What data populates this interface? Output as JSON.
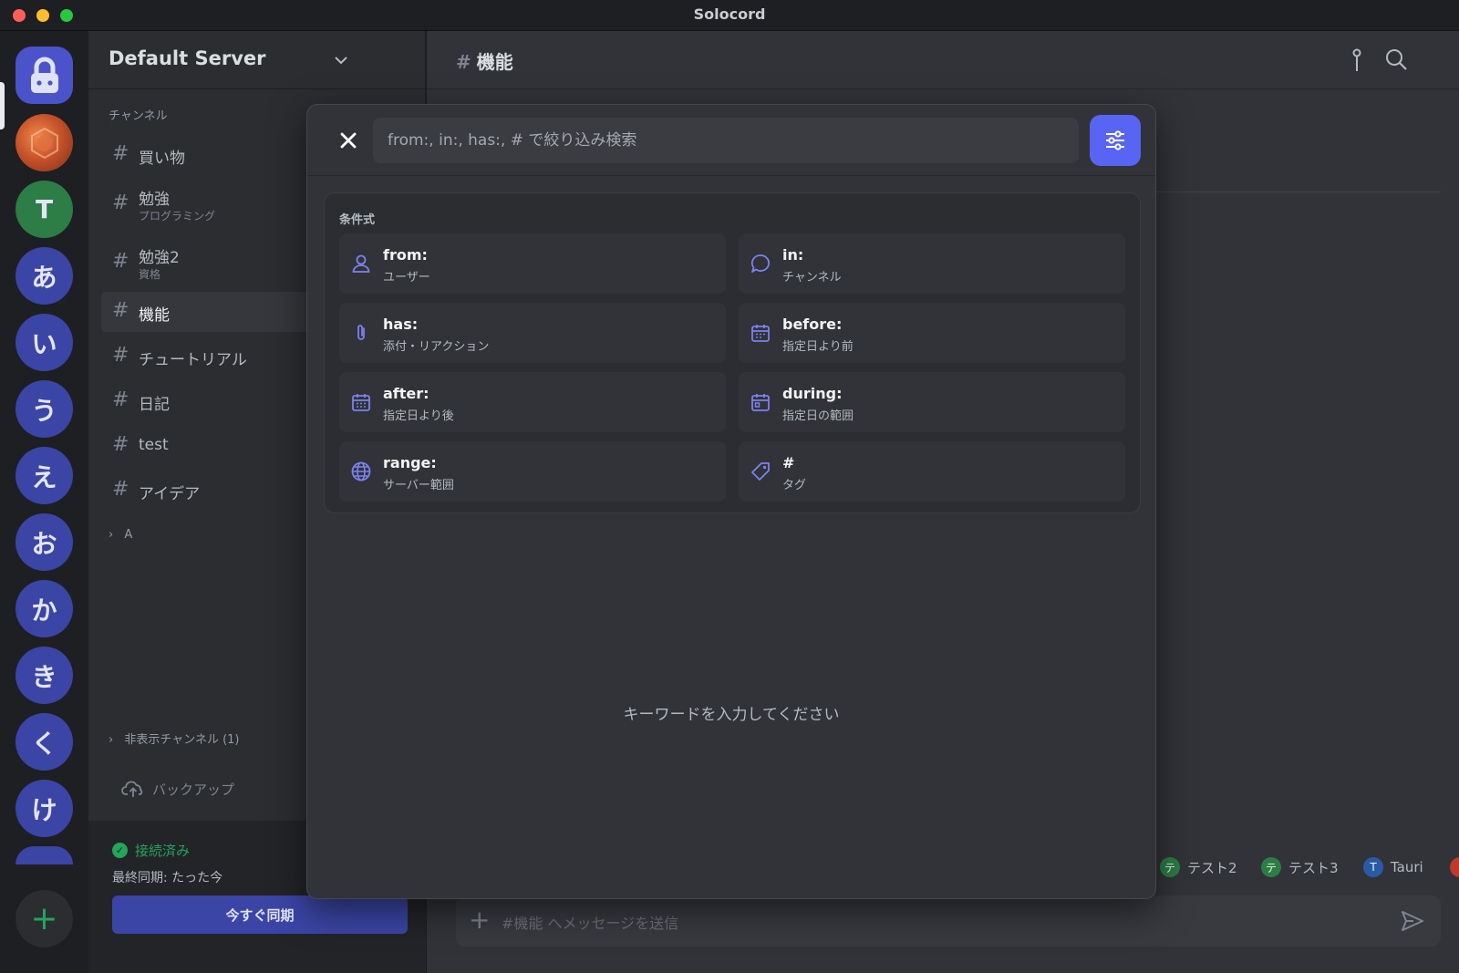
{
  "window": {
    "title": "Solocord"
  },
  "rail": {
    "items": [
      {
        "label": "T"
      },
      {
        "label": "あ"
      },
      {
        "label": "い"
      },
      {
        "label": "う"
      },
      {
        "label": "え"
      },
      {
        "label": "お"
      },
      {
        "label": "か"
      },
      {
        "label": "き"
      },
      {
        "label": "く"
      },
      {
        "label": "け"
      }
    ],
    "add_label": "+"
  },
  "sidebar": {
    "server_name": "Default Server",
    "section_label": "チャンネル",
    "channels": [
      {
        "name": "買い物",
        "sub": ""
      },
      {
        "name": "勉強",
        "sub": "プログラミング"
      },
      {
        "name": "勉強2",
        "sub": "資格"
      },
      {
        "name": "機能",
        "sub": ""
      },
      {
        "name": "チュートリアル",
        "sub": ""
      },
      {
        "name": "日記",
        "sub": ""
      },
      {
        "name": "test",
        "sub": ""
      },
      {
        "name": "アイデア",
        "sub": ""
      }
    ],
    "folder_a": "A",
    "hidden_channels": "非表示チャンネル (1)",
    "backup_label": "バックアップ",
    "status": "接続済み",
    "last_sync": "最終同期: たった今",
    "sync_button": "今すぐ同期"
  },
  "main": {
    "channel_title": "機能",
    "hash": "#",
    "members": [
      "テスト2",
      "テスト3",
      "Tauri"
    ],
    "member_initials": [
      "テ",
      "テ",
      "T"
    ],
    "composer_placeholder": "#機能 へメッセージを送信"
  },
  "search_modal": {
    "placeholder": "from:, in:, has:, # で絞り込み検索",
    "conditions_title": "条件式",
    "conditions": [
      {
        "key": "from:",
        "desc": "ユーザー",
        "icon": "user-icon"
      },
      {
        "key": "in:",
        "desc": "チャンネル",
        "icon": "chat-bubble-icon"
      },
      {
        "key": "has:",
        "desc": "添付・リアクション",
        "icon": "paperclip-icon"
      },
      {
        "key": "before:",
        "desc": "指定日より前",
        "icon": "calendar-icon"
      },
      {
        "key": "after:",
        "desc": "指定日より後",
        "icon": "calendar-icon"
      },
      {
        "key": "during:",
        "desc": "指定日の範囲",
        "icon": "calendar-icon"
      },
      {
        "key": "range:",
        "desc": "サーバー範囲",
        "icon": "globe-icon"
      },
      {
        "key": "#",
        "desc": "タグ",
        "icon": "tag-icon"
      }
    ],
    "empty_message": "キーワードを入力してください"
  },
  "colors": {
    "accent": "#5865f2",
    "rail_server": "#3b45a6",
    "online": "#23a55a",
    "icon_tint": "#7b83f0"
  }
}
